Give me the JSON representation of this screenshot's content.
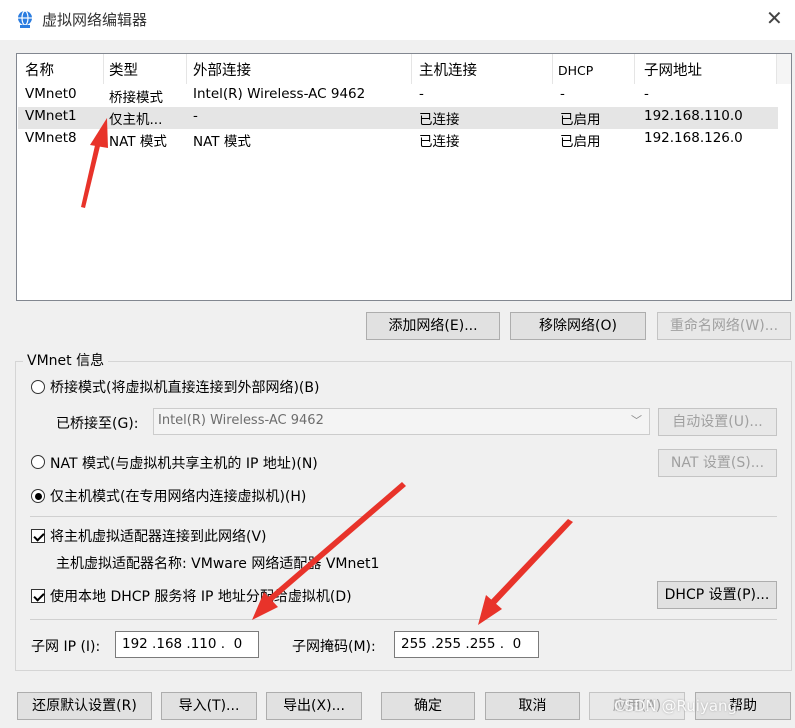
{
  "window": {
    "title": "虚拟网络编辑器",
    "close": "✕"
  },
  "table": {
    "headers": [
      "名称",
      "类型",
      "外部连接",
      "主机连接",
      "DHCP",
      "子网地址"
    ],
    "rows": [
      [
        "VMnet0",
        "桥接模式",
        "Intel(R) Wireless-AC 9462",
        "-",
        "-",
        "-"
      ],
      [
        "VMnet1",
        "仅主机...",
        "-",
        "已连接",
        "已启用",
        "192.168.110.0"
      ],
      [
        "VMnet8",
        "NAT 模式",
        "NAT 模式",
        "已连接",
        "已启用",
        "192.168.126.0"
      ]
    ]
  },
  "net_buttons": {
    "add": "添加网络(E)...",
    "remove": "移除网络(O)",
    "rename": "重命名网络(W)..."
  },
  "vmnet_info": {
    "title": "VMnet 信息",
    "bridge_radio": "桥接模式(将虚拟机直接连接到外部网络)(B)",
    "bridged_to_label": "已桥接至(G):",
    "bridged_to_value": "Intel(R) Wireless-AC 9462",
    "auto_settings": "自动设置(U)...",
    "nat_radio": "NAT 模式(与虚拟机共享主机的 IP 地址)(N)",
    "nat_settings": "NAT 设置(S)...",
    "hostonly_radio": "仅主机模式(在专用网络内连接虚拟机)(H)",
    "connect_adapter_check": "将主机虚拟适配器连接到此网络(V)",
    "adapter_name": "主机虚拟适配器名称: VMware 网络适配器 VMnet1",
    "dhcp_check": "使用本地 DHCP 服务将 IP 地址分配给虚拟机(D)",
    "dhcp_settings": "DHCP 设置(P)...",
    "subnet_ip_label": "子网 IP (I):",
    "subnet_ip_value": "192 .168 .110 .  0",
    "mask_label": "子网掩码(M):",
    "mask_value": "255 .255 .255 .  0"
  },
  "footer_buttons": {
    "restore": "还原默认设置(R)",
    "import": "导入(T)...",
    "export": "导出(X)...",
    "ok": "确定",
    "cancel": "取消",
    "apply": "应用(A)",
    "help": "帮助"
  },
  "watermark": "CSDN @Ruiyang",
  "colors": {
    "arrow": "#e8332a",
    "window_bg": "#f0f0f0",
    "selection": "#e5e5e5"
  }
}
